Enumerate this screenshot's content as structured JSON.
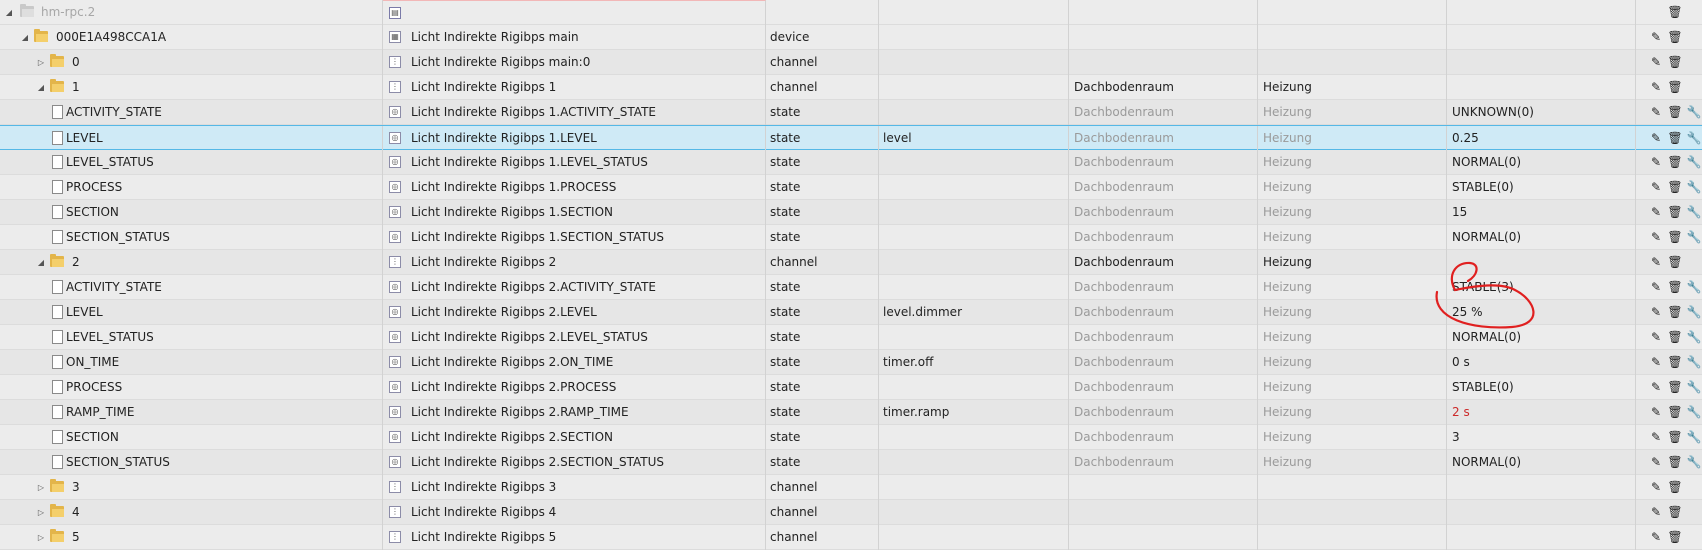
{
  "header": {
    "root_id": "hm-rpc.2",
    "accent_line_color": "#f2b7b7"
  },
  "icons": {
    "edit": "pencil-icon",
    "delete": "trash-icon",
    "settings": "wrench-icon",
    "expand": "triangle-right-icon",
    "collapse": "triangle-down-icon",
    "folder": "folder-icon",
    "file": "file-icon"
  },
  "rows": [
    {
      "id": "000E1A498CCA1A",
      "name": "Licht Indirekte Rigibps main",
      "type": "device",
      "role": "",
      "room": "",
      "function": "",
      "value": ""
    },
    {
      "id": "0",
      "name": "Licht Indirekte Rigibps main:0",
      "type": "channel",
      "role": "",
      "room": "",
      "function": "",
      "value": ""
    },
    {
      "id": "1",
      "name": "Licht Indirekte Rigibps 1",
      "type": "channel",
      "role": "",
      "room": "Dachbodenraum",
      "function": "Heizung",
      "value": ""
    },
    {
      "id": "ACTIVITY_STATE",
      "name": "Licht Indirekte Rigibps 1.ACTIVITY_STATE",
      "type": "state",
      "role": "",
      "room": "Dachbodenraum",
      "function": "Heizung",
      "value": "UNKNOWN(0)"
    },
    {
      "id": "LEVEL",
      "name": "Licht Indirekte Rigibps 1.LEVEL",
      "type": "state",
      "role": "level",
      "room": "Dachbodenraum",
      "function": "Heizung",
      "value": "0.25"
    },
    {
      "id": "LEVEL_STATUS",
      "name": "Licht Indirekte Rigibps 1.LEVEL_STATUS",
      "type": "state",
      "role": "",
      "room": "Dachbodenraum",
      "function": "Heizung",
      "value": "NORMAL(0)"
    },
    {
      "id": "PROCESS",
      "name": "Licht Indirekte Rigibps 1.PROCESS",
      "type": "state",
      "role": "",
      "room": "Dachbodenraum",
      "function": "Heizung",
      "value": "STABLE(0)"
    },
    {
      "id": "SECTION",
      "name": "Licht Indirekte Rigibps 1.SECTION",
      "type": "state",
      "role": "",
      "room": "Dachbodenraum",
      "function": "Heizung",
      "value": "15"
    },
    {
      "id": "SECTION_STATUS",
      "name": "Licht Indirekte Rigibps 1.SECTION_STATUS",
      "type": "state",
      "role": "",
      "room": "Dachbodenraum",
      "function": "Heizung",
      "value": "NORMAL(0)"
    },
    {
      "id": "2",
      "name": "Licht Indirekte Rigibps 2",
      "type": "channel",
      "role": "",
      "room": "Dachbodenraum",
      "function": "Heizung",
      "value": ""
    },
    {
      "id": "ACTIVITY_STATE",
      "name": "Licht Indirekte Rigibps 2.ACTIVITY_STATE",
      "type": "state",
      "role": "",
      "room": "Dachbodenraum",
      "function": "Heizung",
      "value": "STABLE(3)"
    },
    {
      "id": "LEVEL",
      "name": "Licht Indirekte Rigibps 2.LEVEL",
      "type": "state",
      "role": "level.dimmer",
      "room": "Dachbodenraum",
      "function": "Heizung",
      "value": "25 %"
    },
    {
      "id": "LEVEL_STATUS",
      "name": "Licht Indirekte Rigibps 2.LEVEL_STATUS",
      "type": "state",
      "role": "",
      "room": "Dachbodenraum",
      "function": "Heizung",
      "value": "NORMAL(0)"
    },
    {
      "id": "ON_TIME",
      "name": "Licht Indirekte Rigibps 2.ON_TIME",
      "type": "state",
      "role": "timer.off",
      "room": "Dachbodenraum",
      "function": "Heizung",
      "value": "0 s"
    },
    {
      "id": "PROCESS",
      "name": "Licht Indirekte Rigibps 2.PROCESS",
      "type": "state",
      "role": "",
      "room": "Dachbodenraum",
      "function": "Heizung",
      "value": "STABLE(0)"
    },
    {
      "id": "RAMP_TIME",
      "name": "Licht Indirekte Rigibps 2.RAMP_TIME",
      "type": "state",
      "role": "timer.ramp",
      "room": "Dachbodenraum",
      "function": "Heizung",
      "value": "2 s",
      "value_color": "#cc2a2a"
    },
    {
      "id": "SECTION",
      "name": "Licht Indirekte Rigibps 2.SECTION",
      "type": "state",
      "role": "",
      "room": "Dachbodenraum",
      "function": "Heizung",
      "value": "3"
    },
    {
      "id": "SECTION_STATUS",
      "name": "Licht Indirekte Rigibps 2.SECTION_STATUS",
      "type": "state",
      "role": "",
      "room": "Dachbodenraum",
      "function": "Heizung",
      "value": "NORMAL(0)"
    },
    {
      "id": "3",
      "name": "Licht Indirekte Rigibps 3",
      "type": "channel",
      "role": "",
      "room": "",
      "function": "",
      "value": ""
    },
    {
      "id": "4",
      "name": "Licht Indirekte Rigibps 4",
      "type": "channel",
      "role": "",
      "room": "",
      "function": "",
      "value": ""
    },
    {
      "id": "5",
      "name": "Licht Indirekte Rigibps 5",
      "type": "channel",
      "role": "",
      "room": "",
      "function": "",
      "value": ""
    }
  ],
  "selected_row": "Licht Indirekte Rigibps 1.LEVEL",
  "highlight_color": "#e02020"
}
